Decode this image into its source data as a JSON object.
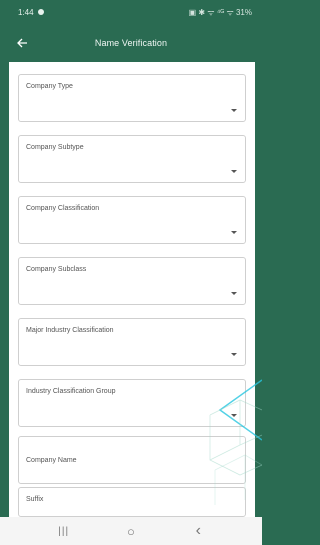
{
  "status_bar": {
    "time": "1:44",
    "indicators": "▣ ✱ ᯤ ⁴ᴳ ᯤ 31%"
  },
  "app_bar": {
    "title": "Name Verification",
    "back_icon": "arrow-left-icon"
  },
  "form": {
    "fields": [
      {
        "label": "Company Type",
        "kind": "dropdown"
      },
      {
        "label": "Company Subtype",
        "kind": "dropdown"
      },
      {
        "label": "Company Classification",
        "kind": "dropdown"
      },
      {
        "label": "Company Subclass",
        "kind": "dropdown"
      },
      {
        "label": "Major Industry Classification",
        "kind": "dropdown"
      },
      {
        "label": "Industry Classification Group",
        "kind": "dropdown"
      },
      {
        "label": "Company Name",
        "kind": "text"
      },
      {
        "label": "Suffix",
        "kind": "text"
      }
    ]
  },
  "nav_bar": {
    "recents_icon": "recents-icon",
    "home_icon": "home-icon",
    "back_icon": "back-chevron-icon",
    "recents_glyph": "|||",
    "home_glyph": "○",
    "back_glyph": "‹"
  },
  "colors": {
    "header_bg": "#2a6b52",
    "card_bg": "#ffffff",
    "border": "#cfcfcf"
  }
}
